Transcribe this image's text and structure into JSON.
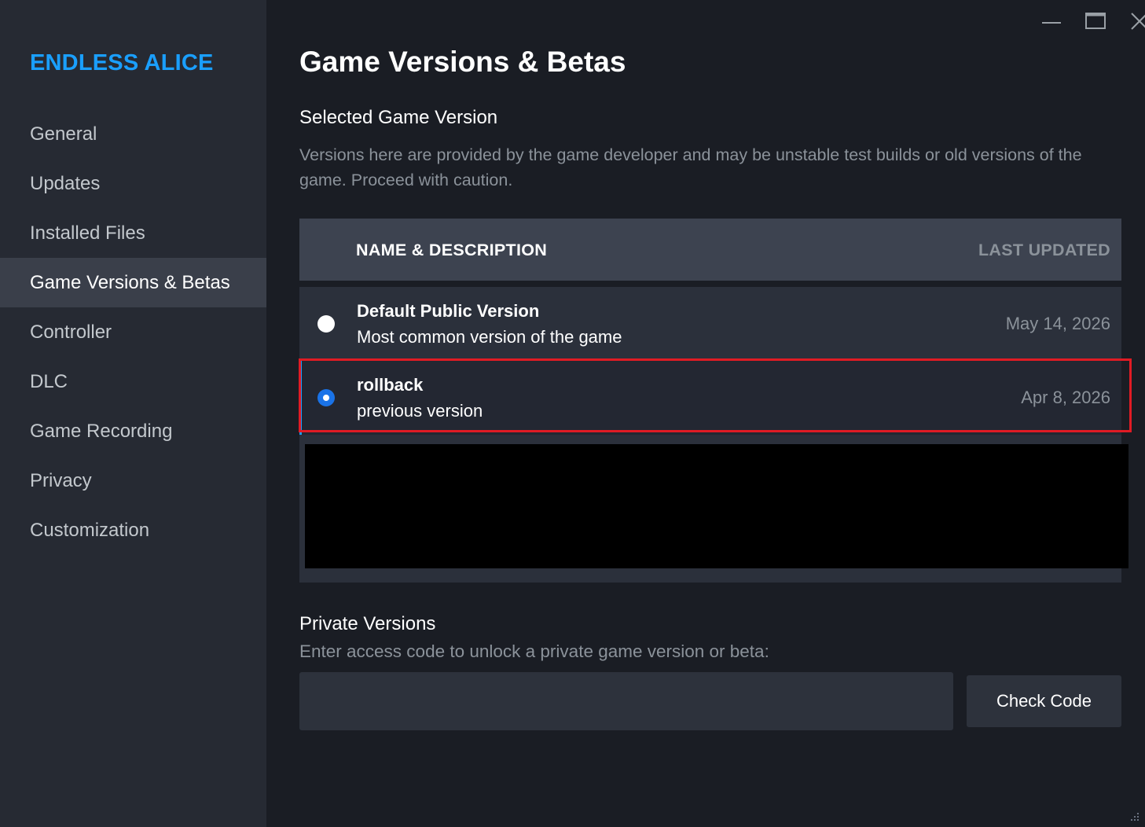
{
  "sidebar": {
    "game_title": "ENDLESS ALICE",
    "items": [
      {
        "label": "General"
      },
      {
        "label": "Updates"
      },
      {
        "label": "Installed Files"
      },
      {
        "label": "Game Versions & Betas"
      },
      {
        "label": "Controller"
      },
      {
        "label": "DLC"
      },
      {
        "label": "Game Recording"
      },
      {
        "label": "Privacy"
      },
      {
        "label": "Customization"
      }
    ],
    "active_item": "Game Versions & Betas"
  },
  "window_controls": {
    "icons": [
      "minimize-icon",
      "maximize-icon",
      "close-icon"
    ]
  },
  "main": {
    "title": "Game Versions & Betas",
    "section_title": "Selected Game Version",
    "section_desc": "Versions here are provided by the game developer and may be unstable test builds or old versions of the game. Proceed with caution.",
    "table": {
      "col_name": "NAME & DESCRIPTION",
      "col_updated": "LAST UPDATED",
      "rows": [
        {
          "name": "Default Public Version",
          "desc": "Most common version of the game",
          "date": "May 14, 2026",
          "selected": false
        },
        {
          "name": "rollback",
          "desc": "previous version",
          "date": "Apr 8, 2026",
          "selected": true
        }
      ]
    },
    "private": {
      "title": "Private Versions",
      "desc": "Enter access code to unlock a private game version or beta:",
      "input_value": "",
      "button_label": "Check Code"
    }
  },
  "colors": {
    "accent": "#1a9fff",
    "highlight_border": "#e01b24",
    "radio_selected": "#1a73e8"
  }
}
